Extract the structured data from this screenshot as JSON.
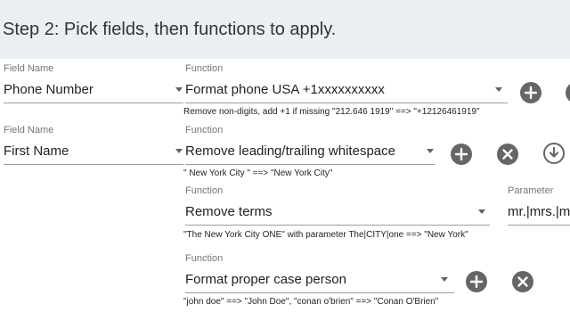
{
  "header": {
    "title": "Step 2: Pick fields, then functions to apply."
  },
  "labels": {
    "field_name": "Field Name",
    "function": "Function",
    "parameter": "Parameter"
  },
  "rows": [
    {
      "field_name": "Phone Number",
      "function": "Format phone USA +1xxxxxxxxxx",
      "description": "Remove non-digits, add +1 if missing \"212.646 1919\" ==> \"+12126461919\""
    },
    {
      "field_name": "First Name",
      "function": "Remove leading/trailing whitespace",
      "description": "\" New York City \" ==> \"New York City\""
    },
    {
      "function": "Remove terms",
      "parameter": "mr.|mrs.|m",
      "description": "\"The New York City ONE\" with parameter The|CITY|one ==> \"New York\""
    },
    {
      "function": "Format proper case person",
      "description": "\"john doe\" ==> \"John Doe\", \"conan o'brien\" ==> \"Conan O'Brien\""
    }
  ],
  "icons": {
    "add": "add-circle-icon",
    "remove": "close-circle-icon",
    "move_down": "arrow-down-circle-icon"
  },
  "colors": {
    "header_bg": "#eceff1",
    "icon_fill": "#666666"
  }
}
